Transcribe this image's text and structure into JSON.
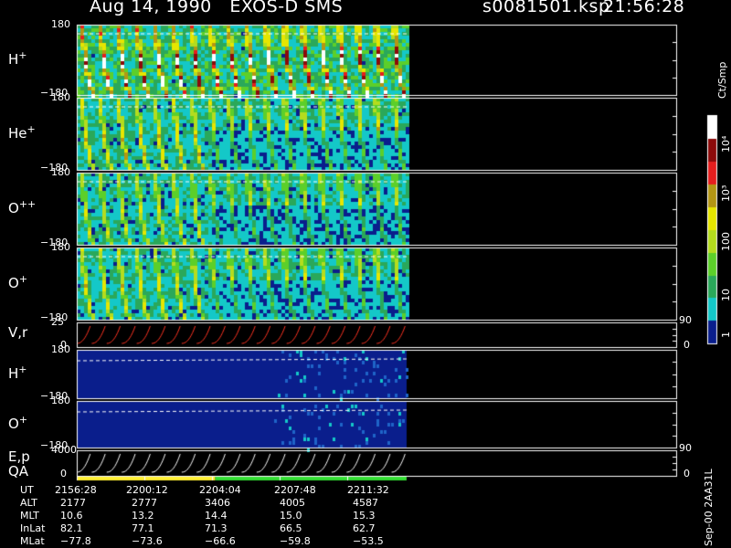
{
  "header": {
    "title": "Aug 14, 1990   EXOS-D SMS",
    "file": "s0081501.ksp",
    "time": "21:56:28"
  },
  "colorbar": {
    "unit": "Ct/Smp",
    "labels": [
      {
        "text": "10⁴",
        "level": 4
      },
      {
        "text": "10³",
        "level": 3
      },
      {
        "text": "100",
        "level": 2
      },
      {
        "text": "10",
        "level": 1
      },
      {
        "text": "1",
        "level": 0
      }
    ]
  },
  "side_label": "Sep-00  2AA31L",
  "chart_data": {
    "type": "heatmap",
    "x_ticks": [
      "2156:28",
      "2200:12",
      "2204:04",
      "2207:48",
      "2211:32"
    ],
    "data_extent_fraction": 0.55,
    "panels": [
      {
        "label": "H",
        "sup": "+",
        "ymax": "180",
        "ymin": "−180",
        "kind": "pitch",
        "intensity": 0.95
      },
      {
        "label": "He",
        "sup": "+",
        "ymax": "180",
        "ymin": "−180",
        "kind": "pitch",
        "intensity": 0.72
      },
      {
        "label": "O",
        "sup": "++",
        "ymax": "180",
        "ymin": "−180",
        "kind": "pitch",
        "intensity": 0.65
      },
      {
        "label": "O",
        "sup": "+",
        "ymax": "180",
        "ymin": "−180",
        "kind": "pitch",
        "intensity": 0.68
      },
      {
        "label": "V,r",
        "sup": "",
        "ymax": "25",
        "ymin": "0",
        "right_max": "90",
        "right_min": "0",
        "kind": "line_red"
      },
      {
        "label": "H",
        "sup": "+",
        "ymax": "180",
        "ymin": "−180",
        "kind": "sparse"
      },
      {
        "label": "O",
        "sup": "+",
        "ymax": "180",
        "ymin": "−180",
        "kind": "sparse"
      },
      {
        "label": "E,p",
        "label2": "QA",
        "sup": "",
        "ymax": "4000",
        "ymin": "0",
        "right_max": "90",
        "right_min": "0",
        "kind": "line_white"
      }
    ]
  },
  "ephemeris": {
    "rows": [
      {
        "label": "UT",
        "values": [
          "2156:28",
          "2200:12",
          "2204:04",
          "2207:48",
          "2211:32"
        ]
      },
      {
        "label": "ALT",
        "values": [
          "2177",
          "2777",
          "3406",
          "4005",
          "4587"
        ]
      },
      {
        "label": "MLT",
        "values": [
          "10.6",
          "13.2",
          "14.4",
          "15.0",
          "15.3"
        ]
      },
      {
        "label": "InLat",
        "values": [
          "82.1",
          "77.1",
          "71.3",
          "66.5",
          "62.7"
        ]
      },
      {
        "label": "MLat",
        "values": [
          "−77.8",
          "−73.6",
          "−66.6",
          "−59.8",
          "−53.5"
        ]
      }
    ]
  },
  "colors": {
    "background": "#000000",
    "qa_yellow": "#ffee33",
    "qa_green": "#33dd33",
    "line_red": "#ff3322"
  }
}
